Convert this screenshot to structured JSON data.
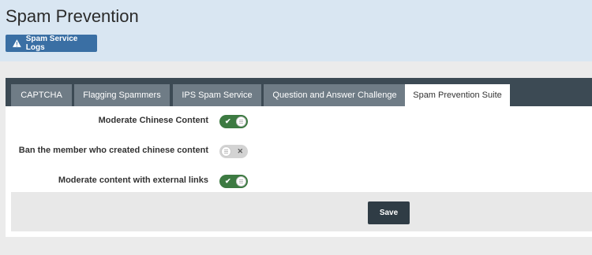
{
  "header": {
    "title": "Spam Prevention",
    "logs_button": {
      "label": "Spam Service Logs",
      "icon": "warning-icon"
    }
  },
  "tabs": [
    {
      "label": "CAPTCHA",
      "active": false
    },
    {
      "label": "Flagging Spammers",
      "active": false
    },
    {
      "label": "IPS Spam Service",
      "active": false
    },
    {
      "label": "Question and Answer Challenge",
      "active": false
    },
    {
      "label": "Spam Prevention Suite",
      "active": true
    }
  ],
  "settings": [
    {
      "label": "Moderate Chinese Content",
      "enabled": true
    },
    {
      "label": "Ban the member who created chinese content",
      "enabled": false
    },
    {
      "label": "Moderate content with external links",
      "enabled": true
    }
  ],
  "footer": {
    "save_label": "Save"
  },
  "colors": {
    "header_bg": "#d9e6f2",
    "primary_button": "#3a6fa4",
    "tabbar_bg": "#3c4a54",
    "tab_bg": "#6f7c86",
    "toggle_on": "#3d7a42",
    "toggle_off": "#d3d3d3",
    "save_button": "#2f3c45"
  }
}
